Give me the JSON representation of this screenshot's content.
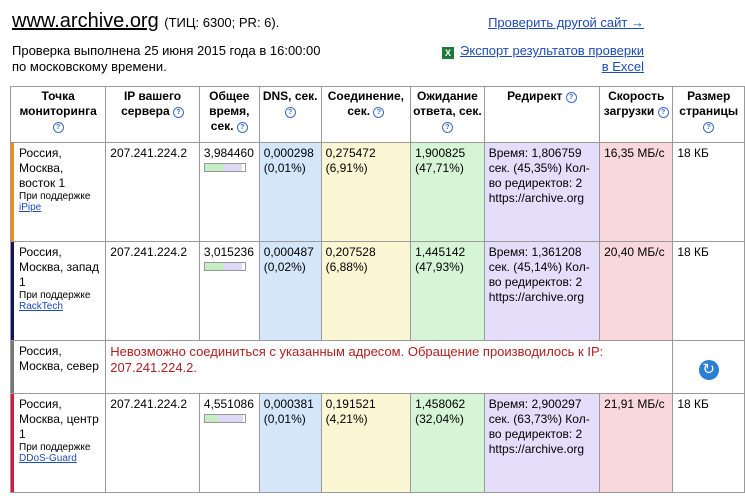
{
  "header": {
    "site": "www.archive.org",
    "site_meta": "(ТИЦ: 6300; PR: 6).",
    "checked_line1": "Проверка выполнена 25 июня 2015 года в 16:00:00",
    "checked_line2": "по московскому времени.",
    "check_other": "Проверить другой сайт →",
    "export_line1": "Экспорт результатов проверки",
    "export_line2": "в Excel",
    "excel_icon": "excel-icon"
  },
  "columns": {
    "point": "Точка мониторинга",
    "ip": "IP вашего сервера",
    "total": "Общее время, сек.",
    "dns": "DNS, сек.",
    "conn": "Соединение, сек.",
    "wait": "Ожидание ответа, сек.",
    "redirect": "Редирект",
    "speed": "Скорость загрузки",
    "size": "Размер страницы"
  },
  "rows": [
    {
      "city": "Россия, Москва, восток 1",
      "sponsor_prefix": "При поддержке",
      "sponsor": "iPipe",
      "color": "#f08a1a",
      "ip": "207.241.224.2",
      "total": "3,984460",
      "dns": "0,000298",
      "dns_pct": "(0,01%)",
      "conn": "0,275472",
      "conn_pct": "(6,91%)",
      "wait": "1,900825",
      "wait_pct": "(47,71%)",
      "redirect": "Время: 1,806759 сек. (45,35%) Кол-во редиректов: 2 https://archive.org",
      "speed": "16,35 МБ/с",
      "size": "18 КБ"
    },
    {
      "city": "Россия, Москва, запад 1",
      "sponsor_prefix": "При поддержке",
      "sponsor": "RackTech",
      "color": "#14145a",
      "ip": "207.241.224.2",
      "total": "3,015236",
      "dns": "0,000487",
      "dns_pct": "(0,02%)",
      "conn": "0,207528",
      "conn_pct": "(6,88%)",
      "wait": "1,445142",
      "wait_pct": "(47,93%)",
      "redirect": "Время: 1,361208 сек. (45,14%) Кол-во редиректов: 2 https://archive.org",
      "speed": "20,40 МБ/с",
      "size": "18 КБ"
    },
    {
      "city": "Россия, Москва, север",
      "color": "#777777",
      "error": "Невозможно соединиться с указанным адресом. Обращение производилось к IP: 207.241.224.2."
    },
    {
      "city": "Россия, Москва, центр 1",
      "sponsor_prefix": "При поддержке",
      "sponsor": "DDoS-Guard",
      "color": "#d81a3a",
      "ip": "207.241.224.2",
      "total": "4,551086",
      "dns": "0,000381",
      "dns_pct": "(0,01%)",
      "conn": "0,191521",
      "conn_pct": "(4,21%)",
      "wait": "1,458062",
      "wait_pct": "(32,04%)",
      "redirect": "Время: 2,900297 сек. (63,73%) Кол-во редиректов: 2 https://archive.org",
      "speed": "21,91 МБ/с",
      "size": "18 КБ"
    }
  ]
}
